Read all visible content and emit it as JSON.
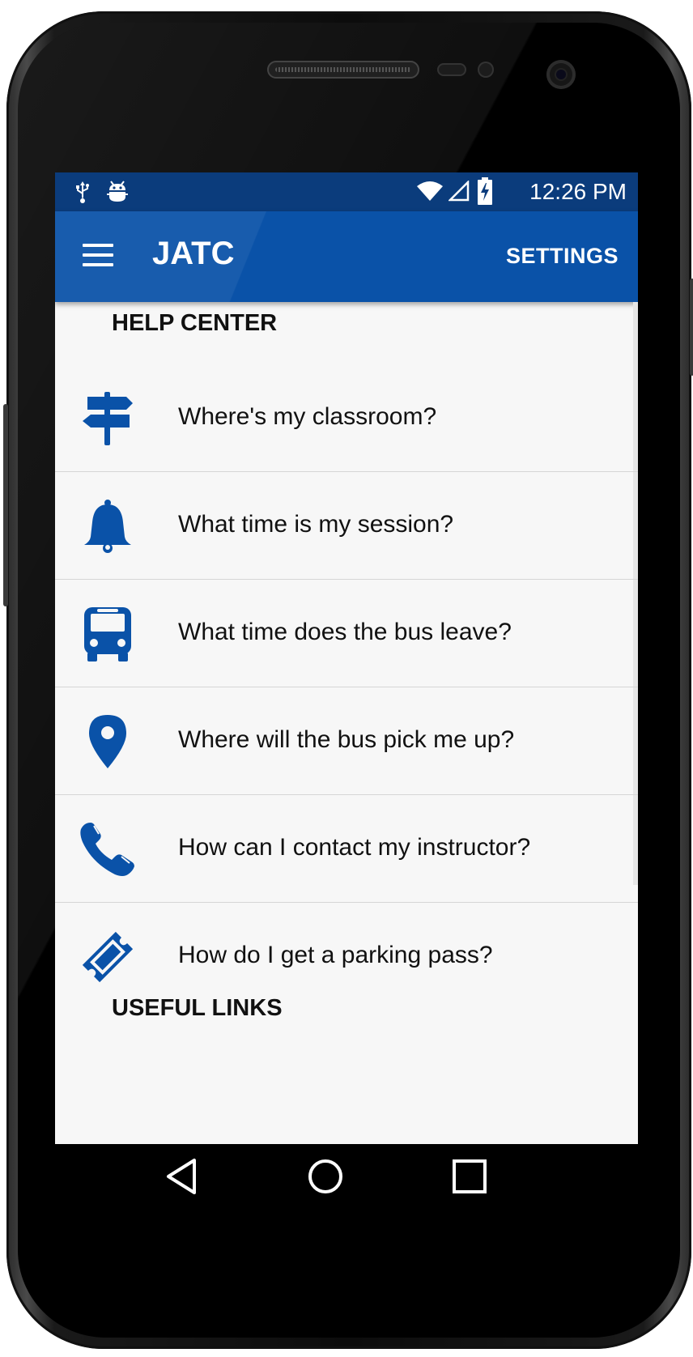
{
  "status_bar": {
    "time": "12:26 PM",
    "icons": [
      "usb-icon",
      "android-debug-icon",
      "wifi-icon",
      "cell-signal-icon",
      "battery-charging-icon"
    ]
  },
  "app_bar": {
    "title": "JATC",
    "menu_icon": "hamburger-menu-icon",
    "settings_label": "SETTINGS"
  },
  "help_center": {
    "title": "HELP CENTER",
    "items": [
      {
        "label": "Where's my classroom?",
        "icon": "signpost-icon"
      },
      {
        "label": "What time is my session?",
        "icon": "bell-icon"
      },
      {
        "label": "What time does the bus leave?",
        "icon": "bus-icon"
      },
      {
        "label": "Where will the bus pick me up?",
        "icon": "map-pin-icon"
      },
      {
        "label": "How can I contact my instructor?",
        "icon": "phone-icon"
      },
      {
        "label": "How do I get a parking pass?",
        "icon": "ticket-icon"
      }
    ]
  },
  "useful_links": {
    "title": "USEFUL LINKS"
  },
  "nav_bar": {
    "icons": [
      "back-icon",
      "home-icon",
      "recents-icon"
    ]
  },
  "colors": {
    "accent": "#0a52a8",
    "status_bar": "#0b3c7c",
    "background": "#f7f7f7"
  }
}
